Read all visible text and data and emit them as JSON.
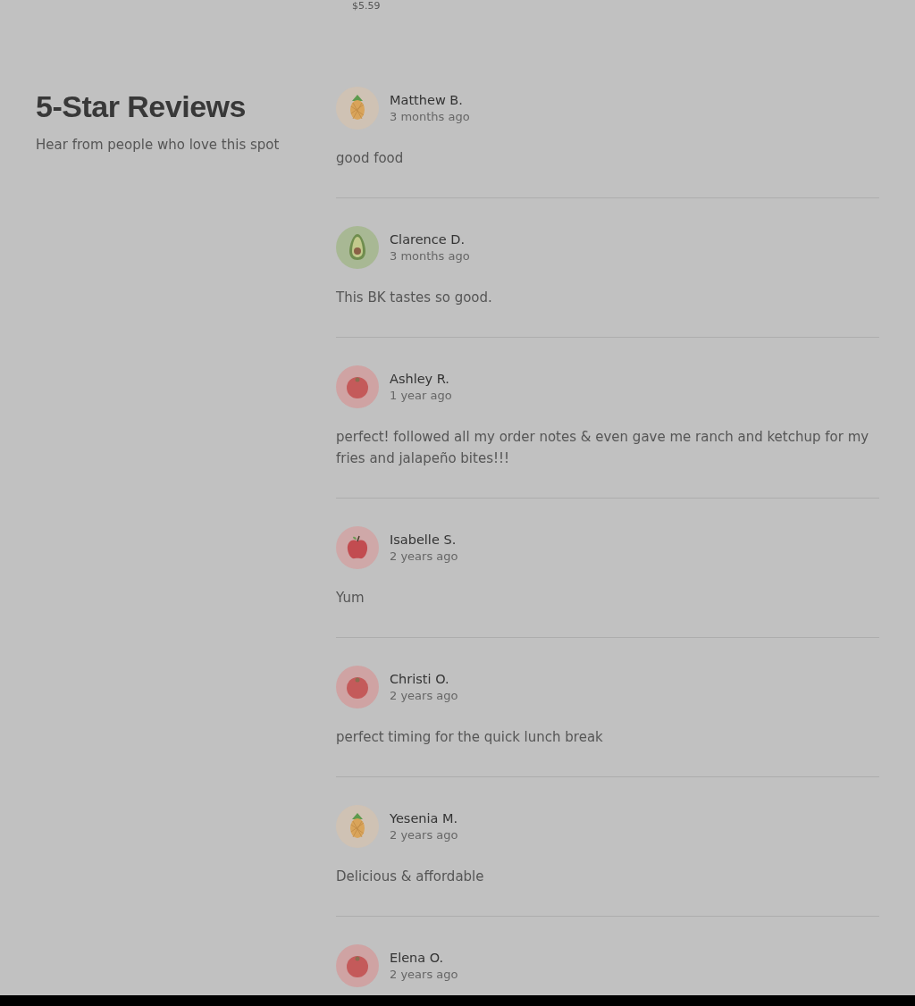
{
  "price": "$5.59",
  "section": {
    "title": "5-Star Reviews",
    "subtitle": "Hear from people who love this spot"
  },
  "reviews": [
    {
      "name": "Matthew B.",
      "time": "3 months ago",
      "text": "good food",
      "kind": "pineapple"
    },
    {
      "name": "Clarence D.",
      "time": "3 months ago",
      "text": "This BK tastes so good.",
      "kind": "avocado"
    },
    {
      "name": "Ashley R.",
      "time": "1 year ago",
      "text": "perfect! followed all my order notes & even gave me ranch and ketchup for my fries and jalapeño bites!!!",
      "kind": "tomato"
    },
    {
      "name": "Isabelle S.",
      "time": "2 years ago",
      "text": "Yum",
      "kind": "apple"
    },
    {
      "name": "Christi O.",
      "time": "2 years ago",
      "text": "perfect timing for the quick lunch break",
      "kind": "tomato"
    },
    {
      "name": "Yesenia M.",
      "time": "2 years ago",
      "text": "Delicious & affordable",
      "kind": "pineapple"
    },
    {
      "name": "Elena O.",
      "time": "2 years ago",
      "kind": "tomato"
    }
  ]
}
